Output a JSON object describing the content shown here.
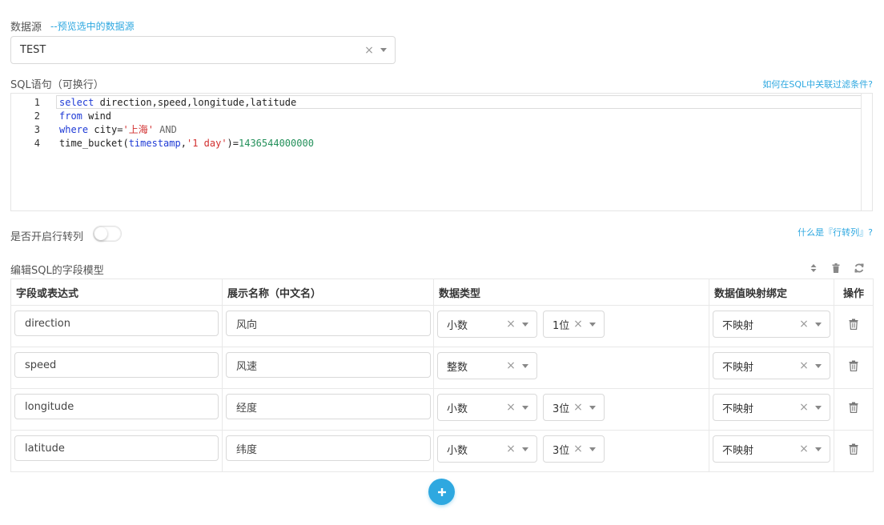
{
  "datasource": {
    "label": "数据源",
    "hint": "--预览选中的数据源",
    "selected": "TEST",
    "clear_icon": "clear-icon",
    "dropdown_icon": "chevron-down-icon"
  },
  "sql": {
    "label": "SQL语句（可换行）",
    "help_link": "如何在SQL中关联过滤条件?",
    "lines": [
      {
        "num": "1",
        "tokens": [
          {
            "t": "select",
            "c": "kw"
          },
          {
            "t": " direction,speed,longitude,latitude",
            "c": ""
          }
        ]
      },
      {
        "num": "2",
        "tokens": [
          {
            "t": "from",
            "c": "kw"
          },
          {
            "t": " wind",
            "c": ""
          }
        ]
      },
      {
        "num": "3",
        "tokens": [
          {
            "t": "where",
            "c": "kw"
          },
          {
            "t": " city=",
            "c": ""
          },
          {
            "t": "'上海'",
            "c": "str"
          },
          {
            "t": " AND",
            "c": "gray"
          }
        ]
      },
      {
        "num": "4",
        "tokens": [
          {
            "t": "time_bucket(",
            "c": ""
          },
          {
            "t": "timestamp",
            "c": "kw"
          },
          {
            "t": ",",
            "c": ""
          },
          {
            "t": "'1 day'",
            "c": "str"
          },
          {
            "t": ")=",
            "c": ""
          },
          {
            "t": "1436544000000",
            "c": "num"
          }
        ]
      }
    ]
  },
  "pivot": {
    "label": "是否开启行转列",
    "enabled": false,
    "help_link": "什么是『行转列』?"
  },
  "model": {
    "label": "编辑SQL的字段模型",
    "tools": [
      "sort-icon",
      "trash-icon",
      "refresh-icon"
    ]
  },
  "table": {
    "headers": [
      "字段或表达式",
      "展示名称（中文名）",
      "数据类型",
      "数据值映射绑定",
      "操作"
    ],
    "rows": [
      {
        "field": "direction",
        "display": "风向",
        "type": "小数",
        "precision": "1位",
        "mapping": "不映射"
      },
      {
        "field": "speed",
        "display": "风速",
        "type": "整数",
        "precision": "",
        "mapping": "不映射"
      },
      {
        "field": "longitude",
        "display": "经度",
        "type": "小数",
        "precision": "3位",
        "mapping": "不映射"
      },
      {
        "field": "latitude",
        "display": "纬度",
        "type": "小数",
        "precision": "3位",
        "mapping": "不映射"
      }
    ]
  },
  "add_button_icon": "plus-icon",
  "colors": {
    "accent": "#2ea8e0",
    "keyword": "#1f3bd6",
    "string": "#d22f2f",
    "number": "#23905a"
  }
}
